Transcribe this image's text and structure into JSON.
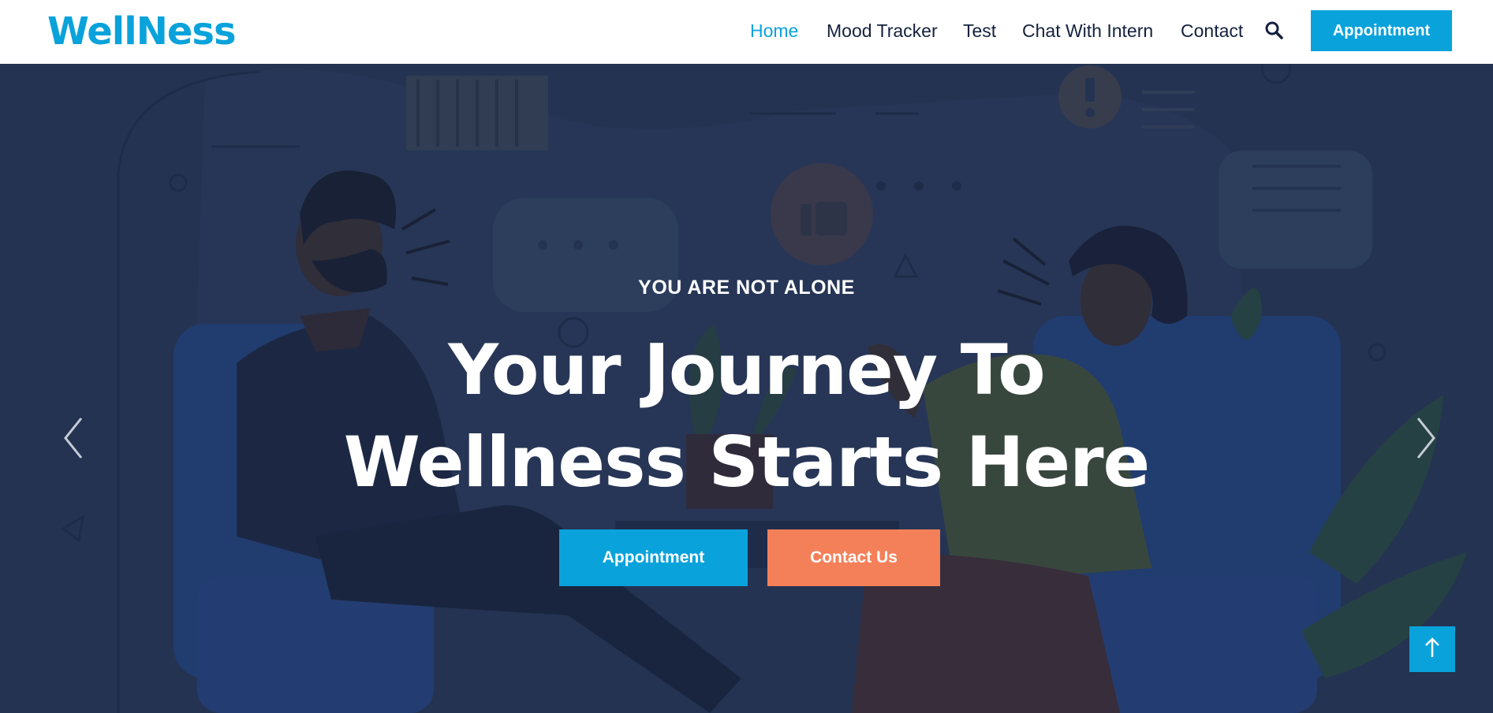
{
  "brand": {
    "logo_text": "WellNess",
    "color": "#0aa2db"
  },
  "nav": {
    "items": [
      {
        "label": "Home",
        "active": true
      },
      {
        "label": "Mood Tracker",
        "active": false
      },
      {
        "label": "Test",
        "active": false
      },
      {
        "label": "Chat With Intern",
        "active": false
      },
      {
        "label": "Contact",
        "active": false
      }
    ],
    "search_icon": "search-icon",
    "cta_label": "Appointment"
  },
  "hero": {
    "eyebrow": "YOU ARE NOT ALONE",
    "headline_line1": "Your Journey To",
    "headline_line2": "Wellness Starts Here",
    "primary_button": "Appointment",
    "secondary_button": "Contact Us",
    "prev_icon": "chevron-left-icon",
    "next_icon": "chevron-right-icon"
  },
  "back_to_top_icon": "arrow-up-icon",
  "colors": {
    "primary": "#0aa2db",
    "accent": "#f4805a",
    "nav_text": "#14213d",
    "hero_bg": "#2c3b5c"
  }
}
